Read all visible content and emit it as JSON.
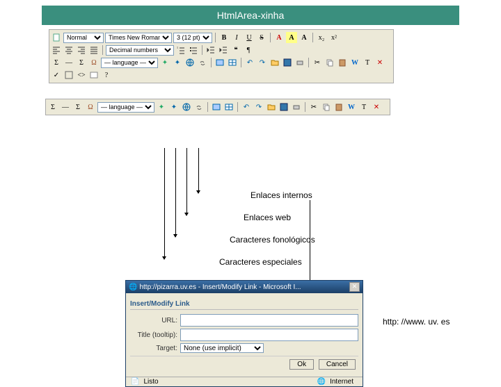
{
  "title": "HtmlArea-xinha",
  "toolbar": {
    "format_select": "Normal",
    "font_select": "Times New Roman",
    "size_select": "3 (12 pt)",
    "list_style": "Decimal numbers",
    "language": "— language —"
  },
  "callouts": {
    "internal_links": "Enlaces internos",
    "web_links": "Enlaces web",
    "phono_chars": "Caracteres fonológicos",
    "special_chars": "Caracteres especiales"
  },
  "dialog": {
    "window_title": "http://pizarra.uv.es - Insert/Modify Link - Microsoft I...",
    "section": "Insert/Modify Link",
    "url_label": "URL:",
    "url_value": "",
    "title_label": "Title (tooltip):",
    "title_value": "",
    "target_label": "Target:",
    "target_value": "None (use implicit)",
    "ok": "Ok",
    "cancel": "Cancel",
    "status_done": "Listo",
    "status_zone": "Internet"
  },
  "url_note": "http: //www. uv. es"
}
